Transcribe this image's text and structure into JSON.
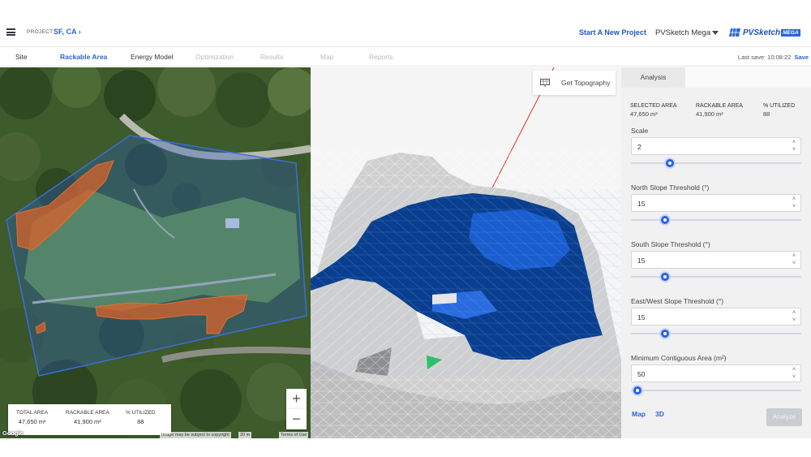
{
  "header": {
    "project_label": "PROJECT",
    "project_name": "SF, CA",
    "project_chevron": "›",
    "new_project_label": "Start A New Project",
    "product_select": "PVSketch Mega",
    "logo_text": "PVSketch",
    "logo_badge": "MEGA"
  },
  "nav": {
    "tabs": [
      {
        "label": "Site",
        "state": "done"
      },
      {
        "label": "Rackable Area",
        "state": "active"
      },
      {
        "label": "Energy Model",
        "state": "done"
      },
      {
        "label": "Optimization",
        "state": "disabled"
      },
      {
        "label": "Results",
        "state": "disabled"
      },
      {
        "label": "Map",
        "state": "disabled"
      },
      {
        "label": "Reports",
        "state": "disabled"
      }
    ],
    "last_save_label": "Last save: 10:08:22",
    "save_link": "Save"
  },
  "map": {
    "stats": [
      {
        "label": "TOTAL AREA",
        "value": "47,650 m²"
      },
      {
        "label": "RACKABLE AREA",
        "value": "41,900 m²"
      },
      {
        "label": "% UTILIZED",
        "value": "88"
      }
    ],
    "zoom_in": "+",
    "zoom_out": "−",
    "attribution_copyright": "Image may be subject to copyright",
    "attribution_scale": "20 m",
    "attribution_terms": "Terms of Use",
    "google_logo": "Google"
  },
  "view3d": {
    "get_topography_label": "Get Topography"
  },
  "panel": {
    "tab_label": "Analysis",
    "stats": [
      {
        "label": "SELECTED AREA",
        "value": "47,650 m²"
      },
      {
        "label": "RACKABLE AREA",
        "value": "41,900 m²"
      },
      {
        "label": "% UTILIZED",
        "value": "88"
      }
    ],
    "fields": [
      {
        "label": "Scale",
        "value": "2",
        "slider_fraction": 0.23
      },
      {
        "label": "North Slope Threshold (°)",
        "value": "15",
        "slider_fraction": 0.2
      },
      {
        "label": "South Slope Threshold (°)",
        "value": "15",
        "slider_fraction": 0.2
      },
      {
        "label": "East/West Slope Threshold (°)",
        "value": "15",
        "slider_fraction": 0.2
      },
      {
        "label": "Minimum Contiguous Area (m²)",
        "value": "50",
        "slider_fraction": 0.04
      }
    ],
    "view_map": "Map",
    "view_3d": "3D",
    "analyze_label": "Analyze"
  },
  "colors": {
    "accent": "#2c64d8",
    "rackable_fill": "#0a3f8f",
    "exclusion_fill": "#d9622b",
    "selection_stroke": "#3b6fd6",
    "terrain": "#d8d8d8"
  },
  "icons": [
    "menu-icon",
    "chevron-right-icon",
    "caret-down-icon",
    "logo-icon",
    "topography-icon",
    "zoom-in-icon",
    "zoom-out-icon",
    "spinner-up-icon",
    "spinner-down-icon"
  ]
}
